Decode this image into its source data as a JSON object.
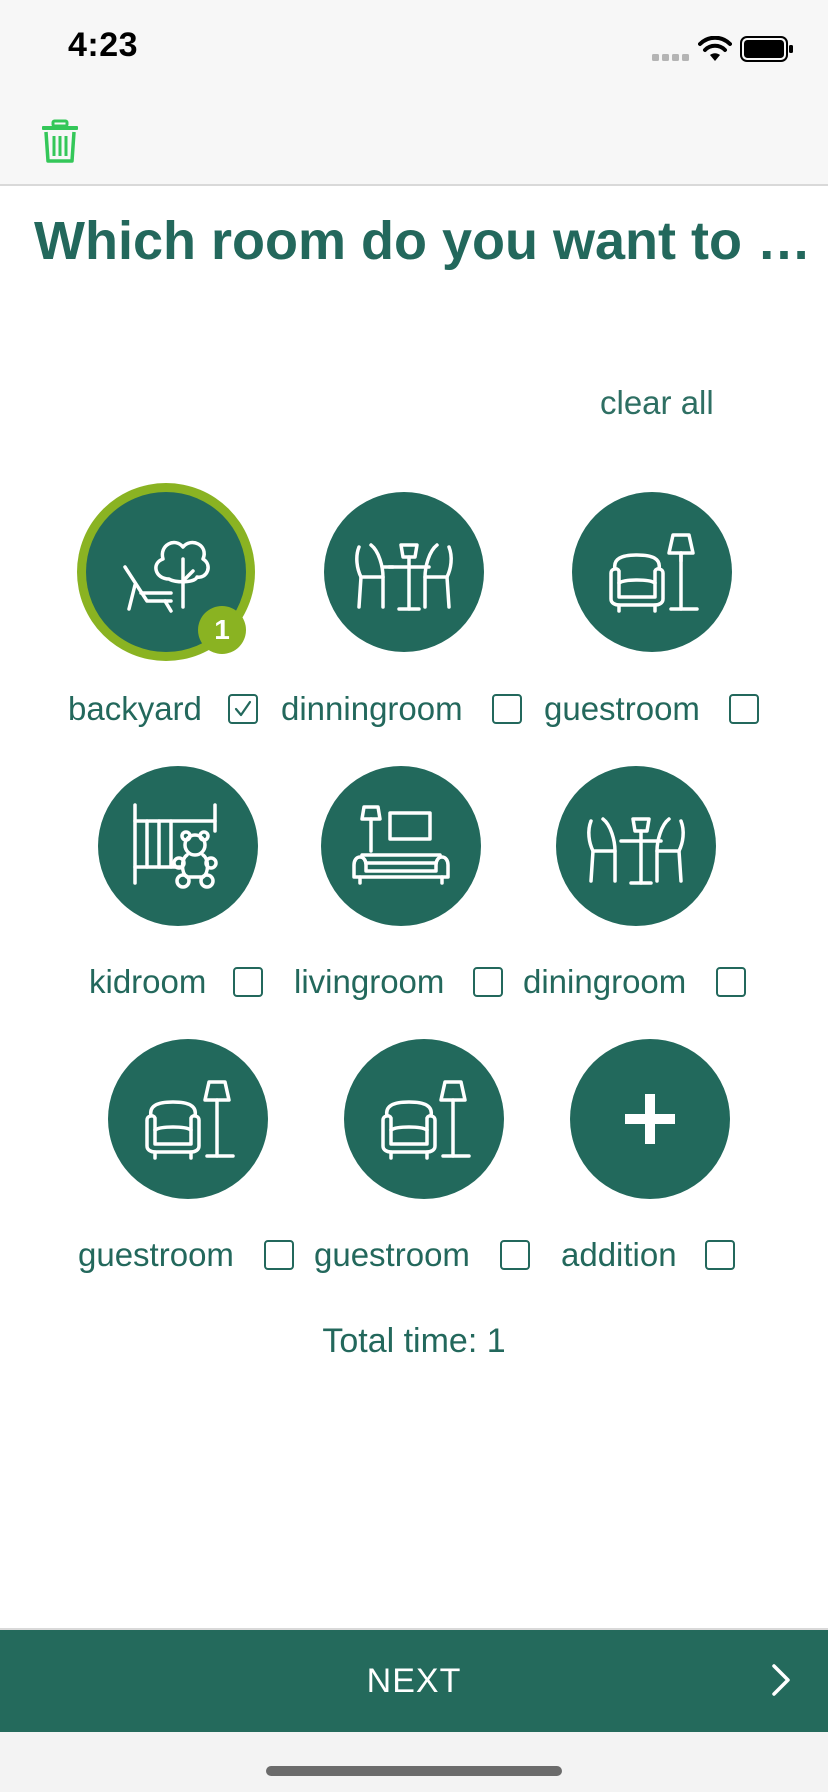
{
  "status_bar": {
    "time": "4:23"
  },
  "nav": {
    "trash_icon": "trash-icon",
    "trash_color": "#34c759"
  },
  "page": {
    "title": "Which room do you want to b…",
    "clear_all": "clear all",
    "total_time": "Total time: 1"
  },
  "rooms": [
    {
      "label": "backyard",
      "icon": "backyard-icon",
      "checked": true,
      "badge": "1"
    },
    {
      "label": "dinningroom",
      "icon": "dining-icon",
      "checked": false
    },
    {
      "label": "guestroom",
      "icon": "guestroom-icon",
      "checked": false
    },
    {
      "label": "kidroom",
      "icon": "kidroom-icon",
      "checked": false
    },
    {
      "label": "livingroom",
      "icon": "livingroom-icon",
      "checked": false
    },
    {
      "label": "diningroom",
      "icon": "dining-icon",
      "checked": false
    },
    {
      "label": "guestroom",
      "icon": "guestroom-icon",
      "checked": false
    },
    {
      "label": "guestroom",
      "icon": "guestroom-icon",
      "checked": false
    },
    {
      "label": "addition",
      "icon": "plus-icon",
      "checked": false
    }
  ],
  "footer": {
    "next_label": "NEXT"
  },
  "colors": {
    "primary": "#22695c",
    "accent": "#8ab322",
    "background": "#ffffff"
  }
}
